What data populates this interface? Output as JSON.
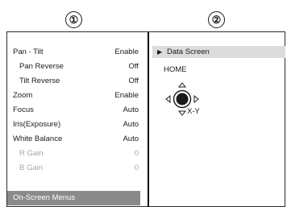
{
  "markers": [
    "①",
    "②"
  ],
  "left_menu": {
    "items": [
      {
        "label": "Pan - Tilt",
        "value": "Enable",
        "indent": false,
        "dim": false
      },
      {
        "label": "Pan Reverse",
        "value": "Off",
        "indent": true,
        "dim": false
      },
      {
        "label": "Tilt Reverse",
        "value": "Off",
        "indent": true,
        "dim": false
      },
      {
        "label": "Zoom",
        "value": "Enable",
        "indent": false,
        "dim": false
      },
      {
        "label": "Focus",
        "value": "Auto",
        "indent": false,
        "dim": false
      },
      {
        "label": "Iris(Exposure)",
        "value": "Auto",
        "indent": false,
        "dim": false
      },
      {
        "label": "White Balance",
        "value": "Auto",
        "indent": false,
        "dim": false
      },
      {
        "label": "R Gain",
        "value": "0",
        "indent": true,
        "dim": true
      },
      {
        "label": "B Gain",
        "value": "0",
        "indent": true,
        "dim": true
      }
    ],
    "selected_label": "On-Screen Menus"
  },
  "right_panel": {
    "data_screen_label": "Data Screen",
    "home_label": "HOME",
    "xy_label": "X-Y"
  },
  "colors": {
    "selected_left": "#8a8a8a",
    "selected_right": "#dcdcdc"
  }
}
